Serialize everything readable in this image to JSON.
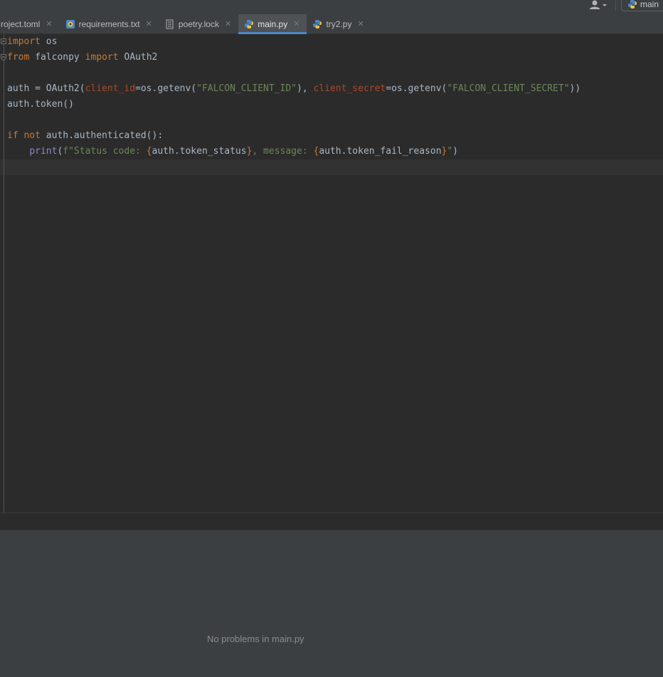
{
  "toolbar": {
    "user_icon": "user-icon",
    "run_config_label": "main",
    "run_config_icon": "python-icon"
  },
  "tabs": [
    {
      "label": "roject.toml",
      "icon": "toml-file-icon",
      "active": false
    },
    {
      "label": "requirements.txt",
      "icon": "requirements-file-icon",
      "active": false
    },
    {
      "label": "poetry.lock",
      "icon": "lock-file-icon",
      "active": false
    },
    {
      "label": "main.py",
      "icon": "python-file-icon",
      "active": true
    },
    {
      "label": "try2.py",
      "icon": "python-file-icon",
      "active": false
    }
  ],
  "code": {
    "l1": {
      "kw": "import",
      "rest": " os"
    },
    "l2": {
      "kw1": "from",
      "mid": " falconpy ",
      "kw2": "import",
      "rest": " OAuth2"
    },
    "l4": {
      "a": "auth = OAuth2(",
      "p1": "client_id",
      "b": "=os.getenv(",
      "s1": "\"FALCON_CLIENT_ID\"",
      "c": "), ",
      "p2": "client_secret",
      "d": "=os.getenv(",
      "s2": "\"FALCON_CLIENT_SECRET\"",
      "e": "))"
    },
    "l5": "auth.token()",
    "l7": {
      "kw1": "if",
      "sp": " ",
      "kw2": "not",
      "rest": " auth.authenticated():"
    },
    "l8": {
      "indent": "    ",
      "fn": "print",
      "open": "(",
      "s1": "f\"Status code: ",
      "b1": "{",
      "v1": "auth.token_status",
      "b2": "}",
      "s2": ", message: ",
      "b3": "{",
      "v2": "auth.token_fail_reason",
      "b4": "}",
      "s3": "\"",
      "close": ")"
    }
  },
  "problems": {
    "empty_message": "No problems in main.py"
  },
  "colors": {
    "keyword": "#cc7832",
    "string": "#6a8759",
    "param": "#aa4926",
    "builtin": "#8888c6",
    "text": "#a9b7c6",
    "accent": "#4a88c7"
  }
}
